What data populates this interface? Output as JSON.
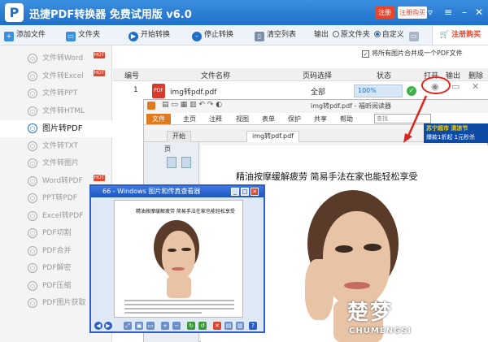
{
  "app": {
    "title": "迅捷PDF转换器 免费试用版 v6.0",
    "register": "注册",
    "buy": "注册购买"
  },
  "toolbar": {
    "add_file": "添加文件",
    "add_folder": "文件夹",
    "start": "开始转换",
    "stop": "停止转换",
    "clear": "清空列表",
    "output_label": "输出",
    "output_original": "原文件夹",
    "output_custom": "自定义",
    "buy_btn": "注册购买"
  },
  "sidebar": {
    "items": [
      {
        "label": "文件转Word",
        "hot": "HOT"
      },
      {
        "label": "文件转Excel",
        "hot": "HOT"
      },
      {
        "label": "文件转PPT",
        "hot": ""
      },
      {
        "label": "文件转HTML",
        "hot": ""
      },
      {
        "label": "图片转PDF",
        "hot": ""
      },
      {
        "label": "文件转TXT",
        "hot": ""
      },
      {
        "label": "文件转图片",
        "hot": ""
      },
      {
        "label": "Word转PDF",
        "hot": "HOT"
      },
      {
        "label": "PPT转PDF",
        "hot": ""
      },
      {
        "label": "Excel转PDF",
        "hot": ""
      },
      {
        "label": "PDF切割",
        "hot": ""
      },
      {
        "label": "PDF合并",
        "hot": ""
      },
      {
        "label": "PDF解密",
        "hot": ""
      },
      {
        "label": "PDF压缩",
        "hot": ""
      },
      {
        "label": "PDF图片获取",
        "hot": ""
      }
    ],
    "active_index": 4
  },
  "main": {
    "merge_option": "将所有图片合并成一个PDF文件",
    "columns": [
      "编号",
      "文件名称",
      "页码选择",
      "状态",
      "打开",
      "输出",
      "删除"
    ],
    "rows": [
      {
        "index": "1",
        "filename": "img转pdf.pdf",
        "pages": "全部",
        "progress_text": "100%",
        "progress": 1.0
      }
    ]
  },
  "viewer": {
    "title": "img转pdf.pdf - 福昕阅读器",
    "file_tab": "文件",
    "menu": [
      "主页",
      "注释",
      "视图",
      "表单",
      "保护",
      "共享",
      "帮助"
    ],
    "search_placeholder": "查找",
    "tabs": [
      "开始",
      "img转pdf.pdf"
    ],
    "left_label": "页",
    "headline": "精油按摩缓解疲劳 简易手法在家也能轻松享受"
  },
  "small_viewer": {
    "title": "66 - Windows 图片和传真查看器",
    "headline": "精油按摩缓解疲劳 简易手法在家也能轻松享受"
  },
  "ad": {
    "line1": "苏宁超市 清凉节",
    "line2": "爆款1折起 1元秒杀"
  },
  "watermark": {
    "big": "楚梦",
    "small": "CHUMENGSI"
  },
  "colors": {
    "title_blue": "#1f6fc9",
    "accent_red": "#e8452d",
    "foxit_orange": "#e07a1f"
  }
}
